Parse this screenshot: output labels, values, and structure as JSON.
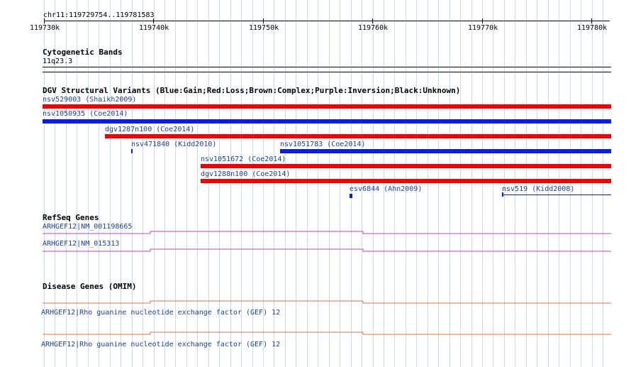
{
  "region": {
    "label": "chr11:119729754..119781583"
  },
  "ruler": {
    "ticks": [
      "119730k",
      "119740k",
      "119750k",
      "119760k",
      "119770k",
      "119780k"
    ]
  },
  "cytoband": {
    "title": "Cytogenetic Bands",
    "band": "11q23.3"
  },
  "dgv": {
    "title": "DGV Structural Variants (Blue:Gain;Red:Loss;Brown:Complex;Purple:Inversion;Black:Unknown)",
    "variants": [
      {
        "id": "v1",
        "label": "nsv529003 (Shaikh2009)",
        "type": "Loss"
      },
      {
        "id": "v2",
        "label": "nsv1050935 (Coe2014)",
        "type": "Gain"
      },
      {
        "id": "v3",
        "label": "dgv1287n100 (Coe2014)",
        "type": "Loss"
      },
      {
        "id": "v4",
        "label": "nsv471840 (Kidd2010)",
        "type": "Gain"
      },
      {
        "id": "v5",
        "label": "nsv1051783 (Coe2014)",
        "type": "Gain"
      },
      {
        "id": "v6",
        "label": "nsv1051672 (Coe2014)",
        "type": "Loss"
      },
      {
        "id": "v7",
        "label": "dgv1288n100 (Coe2014)",
        "type": "Loss"
      },
      {
        "id": "v8",
        "label": "esv6844 (Ahn2009)",
        "type": "Gain"
      },
      {
        "id": "v9",
        "label": "nsv519 (Kidd2008)",
        "type": "Gain"
      }
    ]
  },
  "refseq": {
    "title": "RefSeq Genes",
    "genes": [
      {
        "label": "ARHGEF12|NM_001198665"
      },
      {
        "label": "ARHGEF12|NM_015313"
      }
    ]
  },
  "omim": {
    "title": "Disease Genes (OMIM)",
    "genes": [
      {
        "label": "ARHGEF12|Rho guanine nucleotide exchange factor (GEF) 12"
      },
      {
        "label": "ARHGEF12|Rho guanine nucleotide exchange factor (GEF) 12"
      }
    ]
  },
  "colors": {
    "gain": "#0a1fd6",
    "loss": "#f40000",
    "refseq": "#c040c0",
    "omim": "#e07050",
    "grid": "#c4dcef",
    "link": "#1e3f9c"
  }
}
